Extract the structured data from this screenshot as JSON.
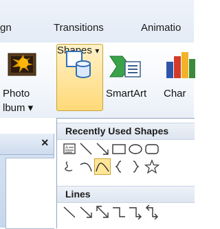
{
  "tabs": [
    "gn",
    "Transitions",
    "Animatio"
  ],
  "ribbon": {
    "photo_album_line1": "Photo",
    "photo_album_line2": "lbum ▾",
    "shapes_label": "Shapes",
    "shapes_arrow": "▾",
    "smartart_label": "SmartArt",
    "chart_label": "Char"
  },
  "pane": {
    "close_glyph": "×"
  },
  "gallery": {
    "recently_used_header": "Recently Used Shapes",
    "lines_header": "Lines",
    "recent_row1": [
      "text-box-icon",
      "line-icon",
      "arrow-line-icon",
      "rectangle-icon",
      "oval-icon",
      "rounded-rectangle-icon"
    ],
    "recent_row2": [
      "freeform-scribble-icon",
      "arc-icon",
      "curve-icon",
      "left-brace-icon",
      "right-brace-icon",
      "star-icon"
    ],
    "lines_row": [
      "line-icon",
      "arrow-line-icon",
      "double-arrow-line-icon",
      "elbow-connector-icon",
      "elbow-arrow-connector-icon",
      "elbow-double-arrow-connector-icon"
    ]
  },
  "colors": {
    "accent_hover": "#ffd978",
    "ribbon_border": "#b9c9de"
  }
}
